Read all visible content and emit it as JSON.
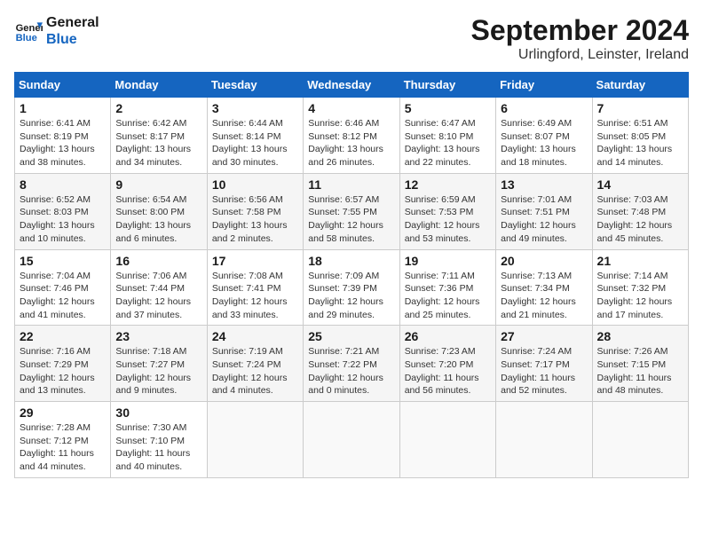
{
  "logo": {
    "line1": "General",
    "line2": "Blue"
  },
  "title": "September 2024",
  "location": "Urlingford, Leinster, Ireland",
  "weekdays": [
    "Sunday",
    "Monday",
    "Tuesday",
    "Wednesday",
    "Thursday",
    "Friday",
    "Saturday"
  ],
  "weeks": [
    [
      {
        "day": "1",
        "info": "Sunrise: 6:41 AM\nSunset: 8:19 PM\nDaylight: 13 hours\nand 38 minutes."
      },
      {
        "day": "2",
        "info": "Sunrise: 6:42 AM\nSunset: 8:17 PM\nDaylight: 13 hours\nand 34 minutes."
      },
      {
        "day": "3",
        "info": "Sunrise: 6:44 AM\nSunset: 8:14 PM\nDaylight: 13 hours\nand 30 minutes."
      },
      {
        "day": "4",
        "info": "Sunrise: 6:46 AM\nSunset: 8:12 PM\nDaylight: 13 hours\nand 26 minutes."
      },
      {
        "day": "5",
        "info": "Sunrise: 6:47 AM\nSunset: 8:10 PM\nDaylight: 13 hours\nand 22 minutes."
      },
      {
        "day": "6",
        "info": "Sunrise: 6:49 AM\nSunset: 8:07 PM\nDaylight: 13 hours\nand 18 minutes."
      },
      {
        "day": "7",
        "info": "Sunrise: 6:51 AM\nSunset: 8:05 PM\nDaylight: 13 hours\nand 14 minutes."
      }
    ],
    [
      {
        "day": "8",
        "info": "Sunrise: 6:52 AM\nSunset: 8:03 PM\nDaylight: 13 hours\nand 10 minutes."
      },
      {
        "day": "9",
        "info": "Sunrise: 6:54 AM\nSunset: 8:00 PM\nDaylight: 13 hours\nand 6 minutes."
      },
      {
        "day": "10",
        "info": "Sunrise: 6:56 AM\nSunset: 7:58 PM\nDaylight: 13 hours\nand 2 minutes."
      },
      {
        "day": "11",
        "info": "Sunrise: 6:57 AM\nSunset: 7:55 PM\nDaylight: 12 hours\nand 58 minutes."
      },
      {
        "day": "12",
        "info": "Sunrise: 6:59 AM\nSunset: 7:53 PM\nDaylight: 12 hours\nand 53 minutes."
      },
      {
        "day": "13",
        "info": "Sunrise: 7:01 AM\nSunset: 7:51 PM\nDaylight: 12 hours\nand 49 minutes."
      },
      {
        "day": "14",
        "info": "Sunrise: 7:03 AM\nSunset: 7:48 PM\nDaylight: 12 hours\nand 45 minutes."
      }
    ],
    [
      {
        "day": "15",
        "info": "Sunrise: 7:04 AM\nSunset: 7:46 PM\nDaylight: 12 hours\nand 41 minutes."
      },
      {
        "day": "16",
        "info": "Sunrise: 7:06 AM\nSunset: 7:44 PM\nDaylight: 12 hours\nand 37 minutes."
      },
      {
        "day": "17",
        "info": "Sunrise: 7:08 AM\nSunset: 7:41 PM\nDaylight: 12 hours\nand 33 minutes."
      },
      {
        "day": "18",
        "info": "Sunrise: 7:09 AM\nSunset: 7:39 PM\nDaylight: 12 hours\nand 29 minutes."
      },
      {
        "day": "19",
        "info": "Sunrise: 7:11 AM\nSunset: 7:36 PM\nDaylight: 12 hours\nand 25 minutes."
      },
      {
        "day": "20",
        "info": "Sunrise: 7:13 AM\nSunset: 7:34 PM\nDaylight: 12 hours\nand 21 minutes."
      },
      {
        "day": "21",
        "info": "Sunrise: 7:14 AM\nSunset: 7:32 PM\nDaylight: 12 hours\nand 17 minutes."
      }
    ],
    [
      {
        "day": "22",
        "info": "Sunrise: 7:16 AM\nSunset: 7:29 PM\nDaylight: 12 hours\nand 13 minutes."
      },
      {
        "day": "23",
        "info": "Sunrise: 7:18 AM\nSunset: 7:27 PM\nDaylight: 12 hours\nand 9 minutes."
      },
      {
        "day": "24",
        "info": "Sunrise: 7:19 AM\nSunset: 7:24 PM\nDaylight: 12 hours\nand 4 minutes."
      },
      {
        "day": "25",
        "info": "Sunrise: 7:21 AM\nSunset: 7:22 PM\nDaylight: 12 hours\nand 0 minutes."
      },
      {
        "day": "26",
        "info": "Sunrise: 7:23 AM\nSunset: 7:20 PM\nDaylight: 11 hours\nand 56 minutes."
      },
      {
        "day": "27",
        "info": "Sunrise: 7:24 AM\nSunset: 7:17 PM\nDaylight: 11 hours\nand 52 minutes."
      },
      {
        "day": "28",
        "info": "Sunrise: 7:26 AM\nSunset: 7:15 PM\nDaylight: 11 hours\nand 48 minutes."
      }
    ],
    [
      {
        "day": "29",
        "info": "Sunrise: 7:28 AM\nSunset: 7:12 PM\nDaylight: 11 hours\nand 44 minutes."
      },
      {
        "day": "30",
        "info": "Sunrise: 7:30 AM\nSunset: 7:10 PM\nDaylight: 11 hours\nand 40 minutes."
      },
      {
        "day": "",
        "info": ""
      },
      {
        "day": "",
        "info": ""
      },
      {
        "day": "",
        "info": ""
      },
      {
        "day": "",
        "info": ""
      },
      {
        "day": "",
        "info": ""
      }
    ]
  ]
}
